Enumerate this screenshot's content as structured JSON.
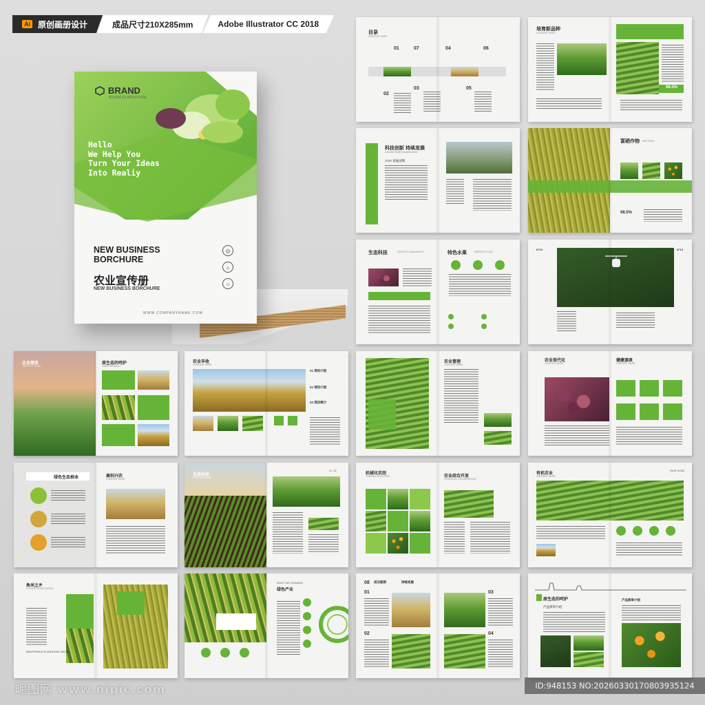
{
  "header": {
    "ai_badge": "Ai",
    "seg1": "原创画册设计",
    "seg2": "成品尺寸210X285mm",
    "seg3": "Adobe Illustrator CC 2018"
  },
  "cover": {
    "brand": "BRAND",
    "brand_sub": "BUSINESS BROCHURE",
    "hello_lines": [
      "Hello",
      "We Help You",
      "Turn Your Ideas",
      "Into Realiy"
    ],
    "title_line1": "NEW BUSINESS",
    "title_line2": "BORCHURE",
    "title_cn": "农业宣传册",
    "subtitle": "NEW BUSINESS BORCHURE",
    "url": "WWW.COMPANYNAME.COM"
  },
  "spreads": {
    "s1": {
      "title": "目录",
      "sub": "CONTENT HERE",
      "items": [
        "01",
        "02",
        "03",
        "04",
        "05",
        "06",
        "07"
      ]
    },
    "s2": {
      "title": "培育新品种",
      "sub": "CONTENT HERE",
      "stat": "98.5%"
    },
    "s3": {
      "title": "科技创新 持续发展",
      "sub": "Life and Health Industrial Base",
      "side": "BUSINESS BROCHURE DESIGN",
      "year": "2030 发展战略"
    },
    "s4": {
      "title": "富硒作物",
      "sub": "OUR TEAM",
      "stat": "98.5%"
    },
    "s5": {
      "title": "生态科技",
      "sub": "SERVICE GUARANTEE",
      "title2": "特色水果",
      "sub2": "SERVICE FLOW"
    },
    "s6": {
      "n1": "N°13",
      "n2": "N°14"
    },
    "s7": {
      "title": "企业理念",
      "sub": "CONTENT HERE",
      "title2": "原生态的呵护",
      "sub2": "CORE PRODUCT"
    },
    "s8": {
      "title": "农业丰收",
      "sub": "CONTENT HERE",
      "items": [
        "01 项目介绍",
        "02 项目介绍",
        "03 项目简介"
      ]
    },
    "s9": {
      "title": "农业管理",
      "sub": "CONTENT HERE"
    },
    "s10": {
      "title": "农业现代化",
      "sub": "CONTENT HERE",
      "title2": "健康源泉",
      "sub2": "CONTENT HERE"
    },
    "s11": {
      "title": "绿色生态根本",
      "title2": "高科兴农",
      "sub2": "CONTENT HERE"
    },
    "s12": {
      "title": "生态科技",
      "sub": "CONTENT HERE",
      "num": "01 / 02"
    },
    "s13": {
      "title": "机械化农田",
      "sub": "OVERALL SOLUTION",
      "title2": "农业综合开发",
      "sub2": "STRATEGIC COOPERATION"
    },
    "s14": {
      "title": "有机农业",
      "sub": "CONTENT HERE",
      "title2": "PAGE GUIDE"
    },
    "s15": {
      "title": "鱼米之乡",
      "sub": "FUTURE EXPECTATION",
      "foot": "NEW PRODUCTS CREATION / DESIGN"
    },
    "s16": {
      "title": "绿色产业",
      "sub": "SINCE THE FOUNDING"
    },
    "s17": {
      "nums": [
        "08",
        "01",
        "02",
        "03",
        "04"
      ],
      "title": "成功案例",
      "title2": "持续发展"
    },
    "s18": {
      "title": "原生态的呵护",
      "sub": "产品简单介绍",
      "title2": "产品简单介绍"
    }
  },
  "footer": {
    "left": "昵图网 www.nipic.com",
    "right": "ID:948153 NO:20260330170803935124"
  }
}
